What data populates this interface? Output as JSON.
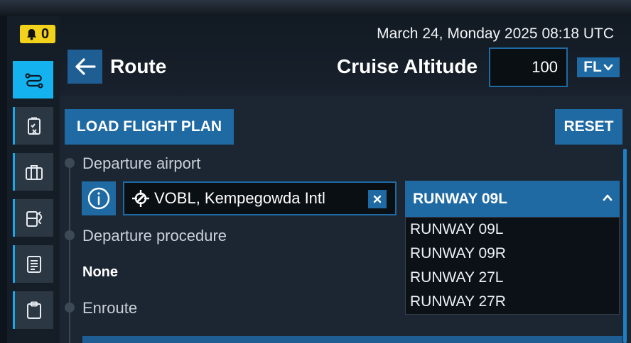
{
  "notifications": {
    "count": "0"
  },
  "header": {
    "datetime": "March 24, Monday 2025 08:18 UTC",
    "title": "Route",
    "cruise_altitude_label": "Cruise Altitude",
    "cruise_altitude_value": "100",
    "altitude_unit": "FL"
  },
  "actions": {
    "load_flight_plan": "LOAD FLIGHT PLAN",
    "reset": "RESET"
  },
  "sidebar": {
    "items": [
      {
        "icon": "route-icon",
        "active": true
      },
      {
        "icon": "checklist-icon",
        "active": false
      },
      {
        "icon": "briefcase-icon",
        "active": false
      },
      {
        "icon": "fuel-icon",
        "active": false
      },
      {
        "icon": "notes-icon",
        "active": false
      },
      {
        "icon": "clipboard-icon",
        "active": false
      }
    ]
  },
  "departure": {
    "label": "Departure airport",
    "airport": "VOBL, Kempegowda Intl",
    "runway_selected": "RUNWAY 09L",
    "runway_options": [
      "RUNWAY 09L",
      "RUNWAY 09R",
      "RUNWAY 27L",
      "RUNWAY 27R"
    ]
  },
  "procedure": {
    "label": "Departure procedure",
    "value": "None"
  },
  "enroute": {
    "label": "Enroute"
  },
  "colors": {
    "accent": "#1f6aa3",
    "active_tab": "#14b2ef",
    "notification": "#f2d21a"
  }
}
